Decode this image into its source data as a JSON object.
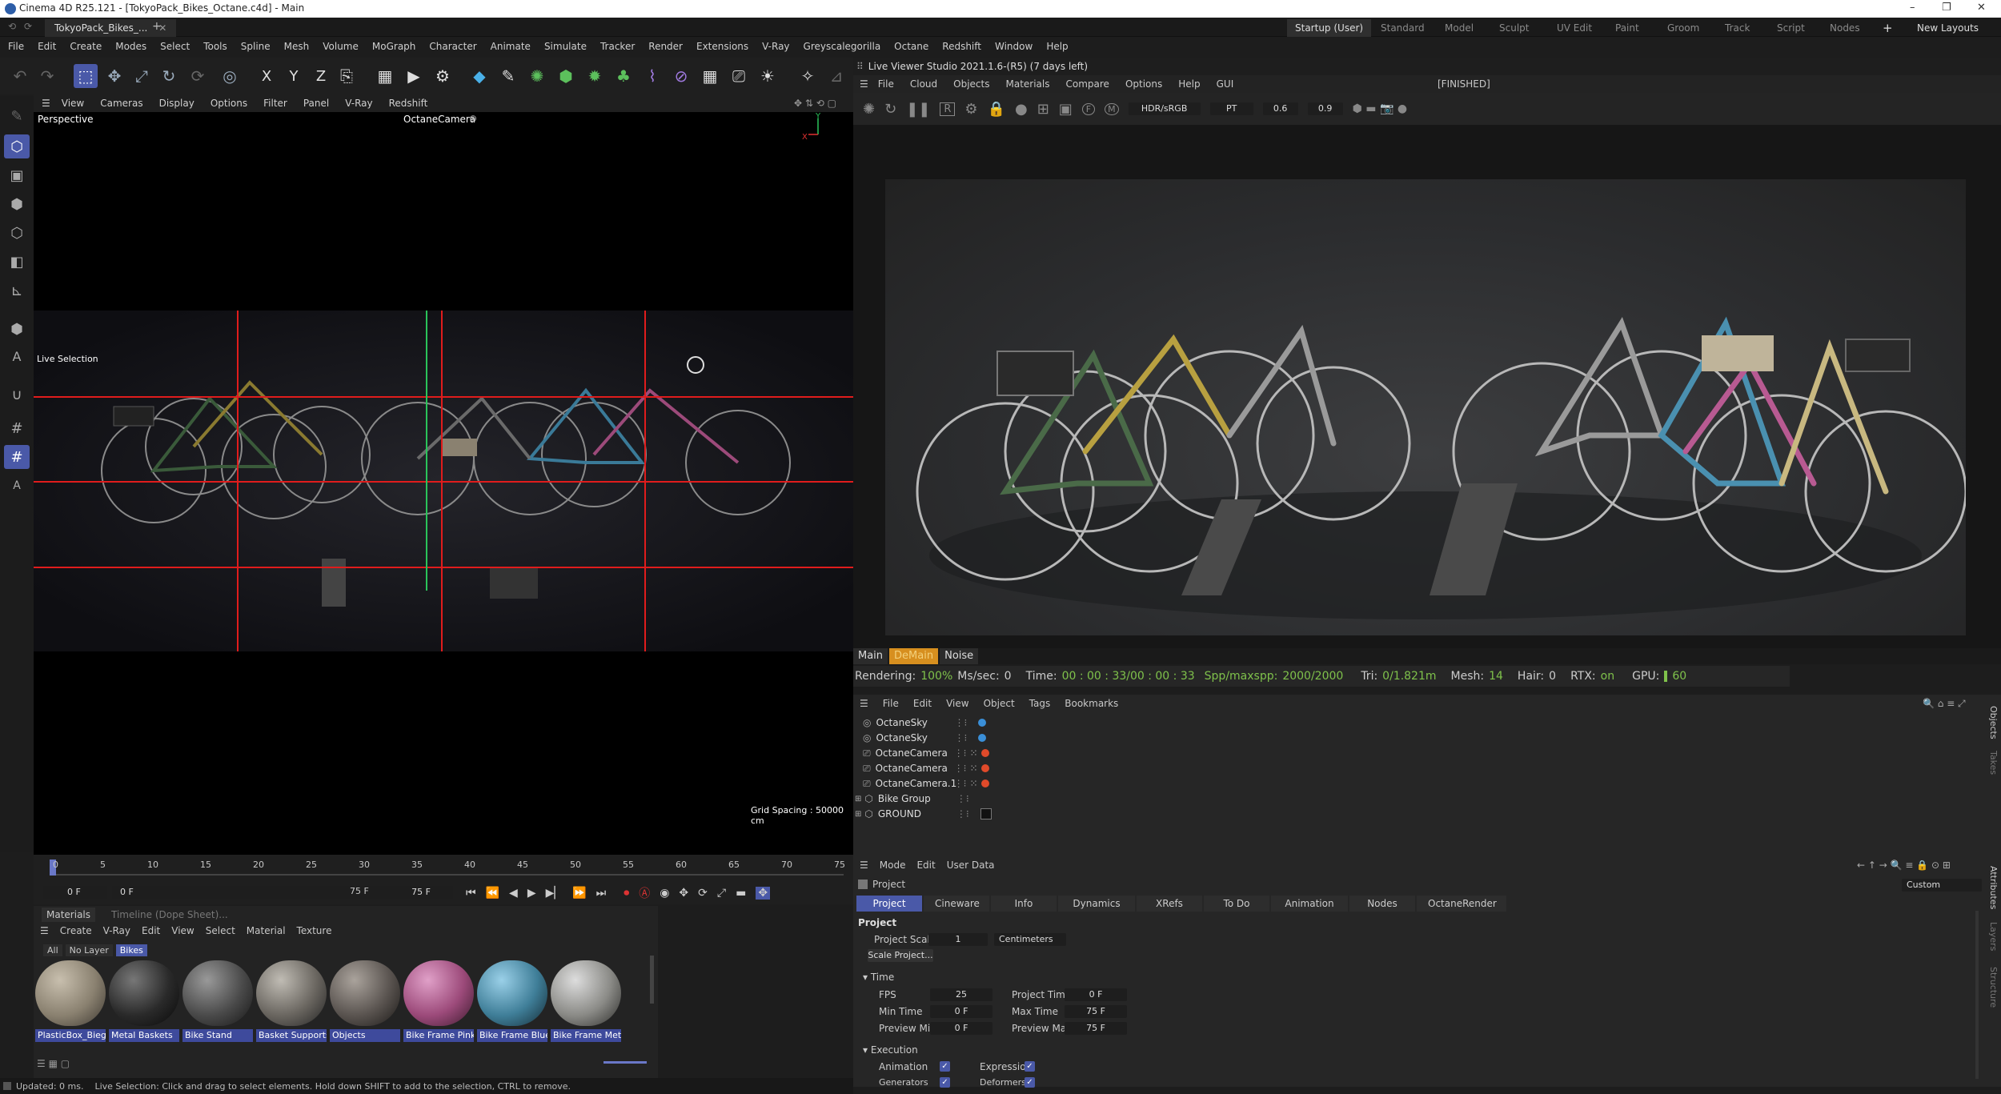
{
  "window": {
    "title": "Cinema 4D R25.121 - [TokyoPack_Bikes_Octane.c4d] - Main",
    "controls": [
      "–",
      "❐",
      "✕"
    ]
  },
  "doc_tab": {
    "label": "TokyoPack_Bikes_...",
    "close": "✕",
    "add": "+"
  },
  "layouts": {
    "items": [
      "Startup (User)",
      "Standard",
      "Model",
      "Sculpt",
      "UV Edit",
      "Paint",
      "Groom",
      "Track",
      "Script",
      "Nodes"
    ],
    "add": "+",
    "new_layouts": "New Layouts"
  },
  "menu": [
    "File",
    "Edit",
    "Create",
    "Modes",
    "Select",
    "Tools",
    "Spline",
    "Mesh",
    "Volume",
    "MoGraph",
    "Character",
    "Animate",
    "Simulate",
    "Tracker",
    "Render",
    "Extensions",
    "V-Ray",
    "Greyscalegorilla",
    "Octane",
    "Redshift",
    "Window",
    "Help"
  ],
  "toolbar_axes": [
    "X",
    "Y",
    "Z"
  ],
  "left_text_tools": [
    "A",
    "A"
  ],
  "viewport": {
    "menu": [
      "View",
      "Cameras",
      "Display",
      "Options",
      "Filter",
      "Panel",
      "V-Ray",
      "Redshift"
    ],
    "view_name": "Perspective",
    "camera": "OctaneCamera",
    "mode_label": "Live Selection",
    "grid_spacing": "Grid Spacing : 50000 cm",
    "axis_y": "Y",
    "axis_x": "X"
  },
  "timeline": {
    "ticks": [
      "0",
      "5",
      "10",
      "15",
      "20",
      "25",
      "30",
      "35",
      "40",
      "45",
      "50",
      "55",
      "60",
      "65",
      "70",
      "75"
    ],
    "current_frame": "0 F",
    "start_frame": "0 F",
    "end_frame_a": "75 F",
    "end_frame_b": "75 F"
  },
  "materials": {
    "tabs": [
      "Materials",
      "Timeline (Dope Sheet)..."
    ],
    "menu": [
      "Create",
      "V-Ray",
      "Edit",
      "View",
      "Select",
      "Material",
      "Texture"
    ],
    "filters": [
      "All",
      "No Layer",
      "Bikes"
    ],
    "items": [
      {
        "name": "PlasticBox_Biege",
        "color": "#8a8170"
      },
      {
        "name": "Metal Baskets",
        "color": "#2a2a2a"
      },
      {
        "name": "Bike Stand",
        "color": "#4a4a4a"
      },
      {
        "name": "Basket Supports",
        "color": "#6a6660"
      },
      {
        "name": "Objects",
        "color": "#5a5450"
      },
      {
        "name": "Bike Frame Pink",
        "color": "#9c4a7a"
      },
      {
        "name": "Bike Frame Blue",
        "color": "#3f7e98"
      },
      {
        "name": "Bike Frame Metal",
        "color": "#8a8a86"
      }
    ]
  },
  "live_viewer": {
    "title": "Live Viewer Studio 2021.1.6-(R5) (7 days left)",
    "status": "[FINISHED]",
    "menu": [
      "File",
      "Cloud",
      "Objects",
      "Materials",
      "Compare",
      "Options",
      "Help",
      "GUI"
    ],
    "tool_icons": [
      "R",
      "F",
      "M"
    ],
    "colorspace": "HDR/sRGB",
    "mode": "PT",
    "value_a": "0.6",
    "value_b": "0.9",
    "tabs": [
      "Main",
      "DeMain",
      "Noise"
    ],
    "stats": {
      "rendering_label": "Rendering:",
      "rendering": "100%",
      "ms_label": "Ms/sec:",
      "ms": "0",
      "time_label": "Time:",
      "time": "00 : 00 : 33/00 : 00 : 33",
      "spp_label": "Spp/maxspp:",
      "spp": "2000/2000",
      "tri_label": "Tri:",
      "tri": "0/1.821m",
      "mesh_label": "Mesh:",
      "mesh": "14",
      "hair_label": "Hair:",
      "hair": "0",
      "rtx_label": "RTX:",
      "rtx": "on",
      "gpu_label": "GPU:",
      "gpu": "60"
    }
  },
  "object_manager": {
    "menu": [
      "File",
      "Edit",
      "View",
      "Object",
      "Tags",
      "Bookmarks"
    ],
    "objects": [
      {
        "name": "OctaneSky",
        "tag_color": "#3a8fd8"
      },
      {
        "name": "OctaneSky",
        "tag_color": "#3a8fd8"
      },
      {
        "name": "OctaneCamera",
        "tag_color": "#e04a2a"
      },
      {
        "name": "OctaneCamera",
        "tag_color": "#e04a2a"
      },
      {
        "name": "OctaneCamera.1",
        "tag_color": "#e04a2a"
      },
      {
        "name": "Bike Group",
        "tag_color": ""
      },
      {
        "name": "GROUND",
        "tag_color": "#777777"
      }
    ],
    "side_tabs": [
      "Objects",
      "Takes"
    ]
  },
  "attributes": {
    "menu": [
      "Mode",
      "Edit",
      "User Data"
    ],
    "preset": "Custom",
    "object_label": "Project",
    "tabs": [
      "Project",
      "Cineware",
      "Info",
      "Dynamics",
      "XRefs",
      "To Do",
      "Animation",
      "Nodes",
      "OctaneRender"
    ],
    "section": "Project",
    "project_scale_label": "Project Scale",
    "project_scale": "1",
    "units": "Centimeters",
    "scale_button": "Scale Project...",
    "time_section": "Time",
    "fps_label": "FPS",
    "fps": "25",
    "project_time_label": "Project Time",
    "project_time": "0 F",
    "min_time_label": "Min Time",
    "min_time": "0 F",
    "max_time_label": "Max Time",
    "max_time": "75 F",
    "preview_min_label": "Preview Min",
    "preview_min": "0 F",
    "preview_max_label": "Preview Max",
    "preview_max": "75 F",
    "execution_section": "Execution",
    "animation_label": "Animation",
    "expression_label": "Expression",
    "generators_label": "Generators",
    "deformers_label": "Deformers",
    "side_tabs": [
      "Attributes",
      "Layers",
      "Structure"
    ]
  },
  "status_bar": {
    "updated": "Updated: 0 ms.",
    "hint": "Live Selection: Click and drag to select elements. Hold down SHIFT to add to the selection, CTRL to remove."
  }
}
